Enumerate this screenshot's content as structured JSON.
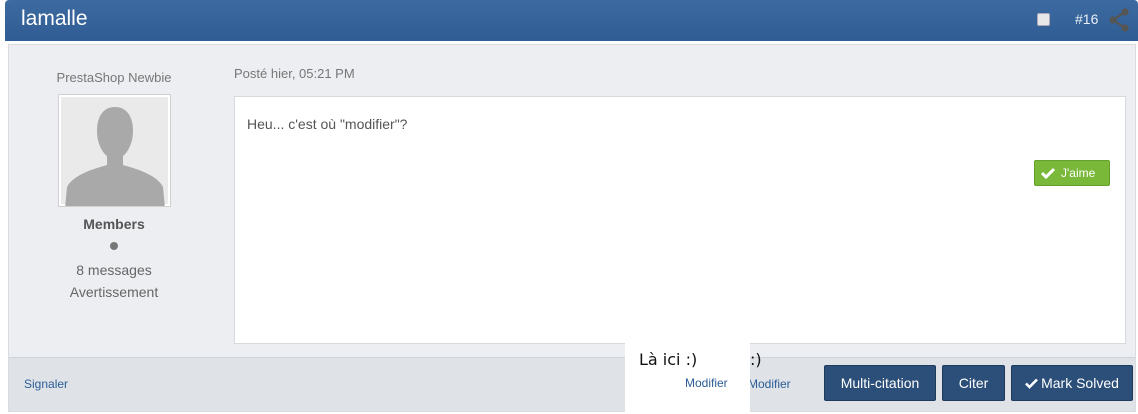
{
  "header": {
    "username": "lamalle",
    "post_number": "#16"
  },
  "author": {
    "rank": "PrestaShop Newbie",
    "group": "Members",
    "messages": "8 messages",
    "warning": "Avertissement"
  },
  "post": {
    "posted": "Posté hier, 05:21 PM",
    "message": "Heu... c'est où \"modifier\"?",
    "like_label": "J'aime"
  },
  "footer": {
    "report": "Signaler",
    "edit": "Modifier",
    "edit_partial": "Modifier",
    "multi_quote": "Multi-citation",
    "quote": "Citer",
    "mark_solved": "Mark Solved"
  },
  "annotation": {
    "text1": "Là ici :)",
    "text2": ":)"
  },
  "colors": {
    "header": "#2f5d93",
    "button": "#2b4f78",
    "like": "#7ab83a",
    "link": "#2a5d96"
  }
}
